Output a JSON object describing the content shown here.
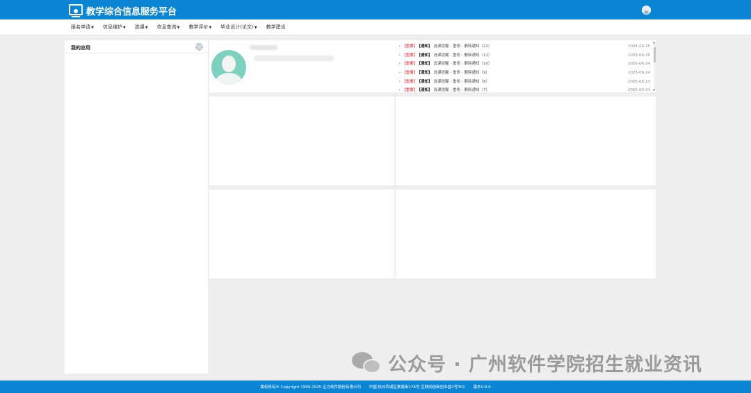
{
  "header": {
    "title": "教学综合信息服务平台",
    "brand_color": "#0b86d5"
  },
  "nav": {
    "items": [
      {
        "label": "报名申请",
        "has_dropdown": true
      },
      {
        "label": "信息维护",
        "has_dropdown": true
      },
      {
        "label": "选课",
        "has_dropdown": true
      },
      {
        "label": "信息查询",
        "has_dropdown": true
      },
      {
        "label": "教学评价",
        "has_dropdown": true
      },
      {
        "label": "毕业设计(论文)",
        "has_dropdown": true
      },
      {
        "label": "教学建设",
        "has_dropdown": false
      }
    ]
  },
  "apps_panel": {
    "title": "我的应用"
  },
  "notices": [
    {
      "tag_important": "【重要】",
      "tag_type": "【通知】",
      "text": "选课提醒 - 重修 - 删除通知（12）",
      "date": "2025-06-25"
    },
    {
      "tag_important": "【重要】",
      "tag_type": "【通知】",
      "text": "选课提醒 - 重修 - 删除通知（11）",
      "date": "2025-06-25"
    },
    {
      "tag_important": "【重要】",
      "tag_type": "【通知】",
      "text": "选课提醒 - 重修 - 删除通知（10）",
      "date": "2025-06-24"
    },
    {
      "tag_important": "【重要】",
      "tag_type": "【通知】",
      "text": "选课提醒 - 重修 - 删除通知（9）",
      "date": "2025-06-24"
    },
    {
      "tag_important": "【重要】",
      "tag_type": "【通知】",
      "text": "选课提醒 - 重修 - 删除通知（8）",
      "date": "2025-06-23"
    },
    {
      "tag_important": "【重要】",
      "tag_type": "【通知】",
      "text": "选课提醒 - 重修 - 删除通知（7）",
      "date": "2025-06-23"
    }
  ],
  "watermark": {
    "text": "公众号 · 广州软件学院招生就业资讯"
  },
  "footer": {
    "copyright": "版权所有© Copyright 1999-2025 正方软件股份有限公司",
    "address": "中国·杭州西湖区紫霞街176号 互联网创新创业园2号301",
    "version": "版本V-9.0"
  }
}
